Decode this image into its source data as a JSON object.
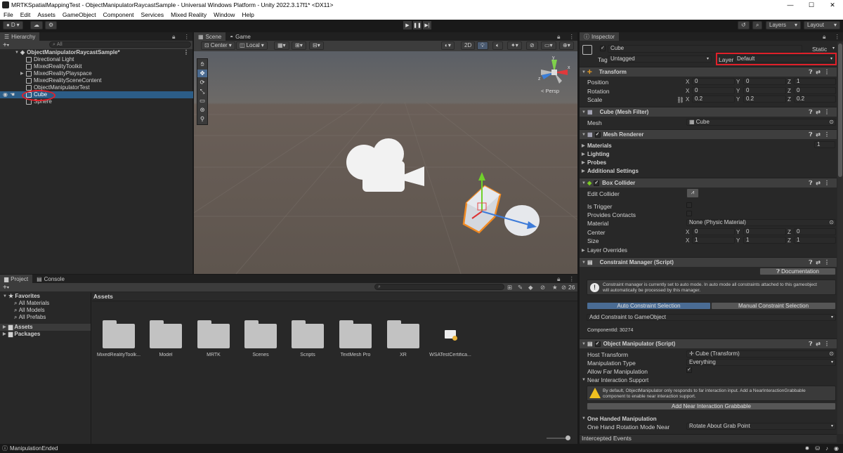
{
  "title_bar": {
    "title": "MRTKSpatialMappingTest - ObjectManipulatorRaycastSample - Universal Windows Platform - Unity 2022.3.17f1* <DX11>",
    "minimize": "—",
    "maximize": "☐",
    "close": "✕"
  },
  "menu": [
    "File",
    "Edit",
    "Assets",
    "GameObject",
    "Component",
    "Services",
    "Mixed Reality",
    "Window",
    "Help"
  ],
  "toolbar": {
    "account": "D",
    "layers": "Layers",
    "layout": "Layout"
  },
  "hierarchy": {
    "tab": "Hierarchy",
    "search_placeholder": "All",
    "root": "ObjectManipulatorRaycastSample*",
    "items": [
      "Directional Light",
      "MixedRealityToolkit",
      "MixedRealityPlayspace",
      "MixedRealitySceneContent",
      "ObjectManipulatorTest",
      "Cube",
      "Sphere"
    ]
  },
  "scene": {
    "tabs": [
      "Scene",
      "Game"
    ],
    "pivot": "Center",
    "space": "Local",
    "mode_2d": "2D",
    "persp": "< Persp",
    "gizmo_y": "y",
    "gizmo_x": "x",
    "gizmo_z": "z"
  },
  "project": {
    "tabs": [
      "Project",
      "Console"
    ],
    "favorites": "Favorites",
    "fav_items": [
      "All Materials",
      "All Models",
      "All Prefabs"
    ],
    "tree": [
      "Assets",
      "Packages"
    ],
    "assets_heading": "Assets",
    "hidden_count": "26",
    "assets": [
      "MixedRealityToolk...",
      "Model",
      "MRTK",
      "Scenes",
      "Scripts",
      "TextMesh Pro",
      "XR",
      "WSATestCertifica..."
    ]
  },
  "inspector": {
    "tab": "Inspector",
    "object_name": "Cube",
    "static": "Static",
    "tag_label": "Tag",
    "tag_value": "Untagged",
    "layer_label": "Layer",
    "layer_value": "Default",
    "transform": {
      "title": "Transform",
      "position_label": "Position",
      "position": [
        "0",
        "0",
        "1"
      ],
      "rotation_label": "Rotation",
      "rotation": [
        "0",
        "0",
        "0"
      ],
      "scale_label": "Scale",
      "scale": [
        "0.2",
        "0.2",
        "0.2"
      ]
    },
    "mesh_filter": {
      "title": "Cube (Mesh Filter)",
      "mesh_label": "Mesh",
      "mesh_value": "Cube"
    },
    "mesh_renderer": {
      "title": "Mesh Renderer",
      "materials": "Materials",
      "materials_count": "1",
      "lighting": "Lighting",
      "probes": "Probes",
      "additional": "Additional Settings"
    },
    "box_collider": {
      "title": "Box Collider",
      "edit_collider": "Edit Collider",
      "is_trigger": "Is Trigger",
      "provides_contacts": "Provides Contacts",
      "material_label": "Material",
      "material_value": "None (Physic Material)",
      "center_label": "Center",
      "center": [
        "0",
        "0",
        "0"
      ],
      "size_label": "Size",
      "size": [
        "1",
        "1",
        "1"
      ],
      "layer_overrides": "Layer Overrides"
    },
    "constraint_manager": {
      "title": "Constraint Manager (Script)",
      "documentation": "Documentation",
      "info_line1": "Constraint manager is currently set to auto mode. In auto mode all constraints attached to this gameobject",
      "info_line2": "will automatically be processed by this manager.",
      "auto_btn": "Auto Constraint Selection",
      "manual_btn": "Manual Constraint Selection",
      "add_constraint": "Add Constraint to GameObject",
      "component_id": "ComponentId: 30274"
    },
    "object_manipulator": {
      "title": "Object Manipulator (Script)",
      "host_label": "Host Transform",
      "host_value": "Cube (Transform)",
      "manip_label": "Manipulation Type",
      "manip_value": "Everything",
      "far_label": "Allow Far Manipulation",
      "near_support": "Near Interaction Support",
      "warn_line1": "By default, ObjectManipulator only responds to far interaction input.  Add a NearInteractionGrabbable",
      "warn_line2": "component to enable near interaction support.",
      "add_near_btn": "Add Near Interaction Grabbable",
      "one_handed": "One Handed Manipulation",
      "rot_label": "One Hand Rotation Mode Near",
      "rot_value": "Rotate About Grab Point"
    },
    "intercepted": "Intercepted Events"
  },
  "status": {
    "message": "ManipulationEnded"
  },
  "colors": {
    "selection": "#2c5d87",
    "highlight": "#e0202a",
    "panel": "#282828"
  }
}
